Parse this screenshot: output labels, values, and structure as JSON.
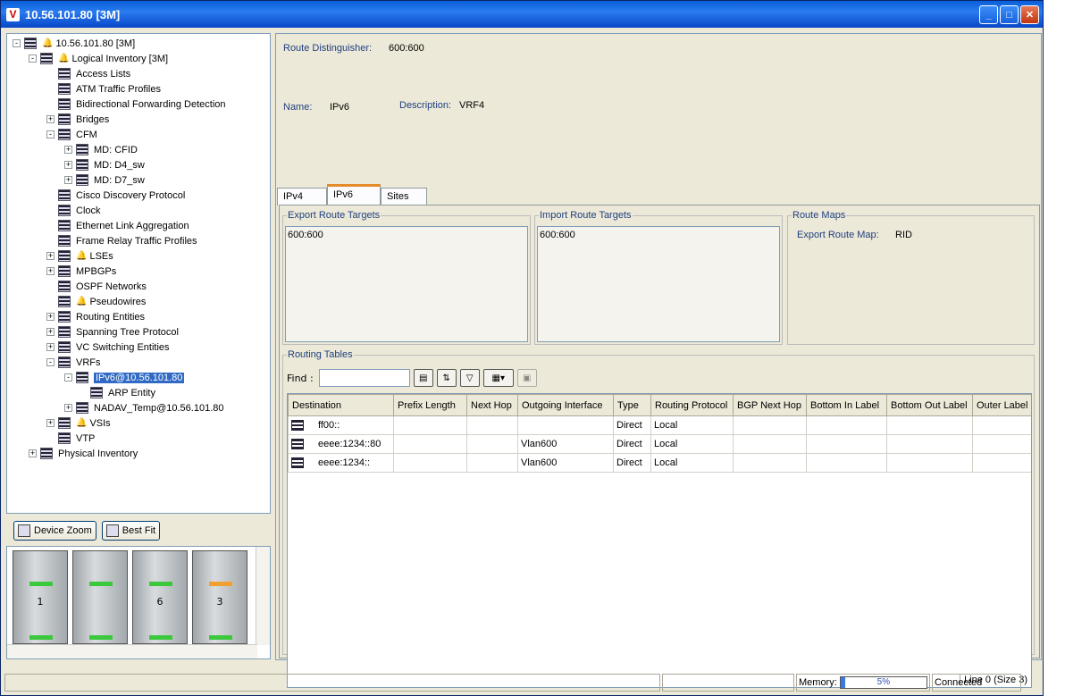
{
  "window": {
    "title": "10.56.101.80 [3M]",
    "logo": "V"
  },
  "tree": [
    {
      "label": "10.56.101.80 [3M]",
      "level": 0,
      "expander": "-",
      "bell": true,
      "icon": "device-icon"
    },
    {
      "label": "Logical Inventory [3M]",
      "level": 1,
      "expander": "-",
      "bell": true,
      "icon": "inventory-icon"
    },
    {
      "label": "Access Lists",
      "level": 2,
      "expander": "",
      "icon": "grid-icon"
    },
    {
      "label": "ATM Traffic Profiles",
      "level": 2,
      "expander": "",
      "icon": "grid-icon"
    },
    {
      "label": "Bidirectional Forwarding Detection",
      "level": 2,
      "expander": "",
      "icon": "grid-icon"
    },
    {
      "label": "Bridges",
      "level": 2,
      "expander": "+",
      "icon": "grid-icon"
    },
    {
      "label": "CFM",
      "level": 2,
      "expander": "-",
      "icon": "cfm-icon"
    },
    {
      "label": "MD: CFID",
      "level": 3,
      "expander": "+",
      "icon": "md-icon"
    },
    {
      "label": "MD: D4_sw",
      "level": 3,
      "expander": "+",
      "icon": "md-icon"
    },
    {
      "label": "MD: D7_sw",
      "level": 3,
      "expander": "+",
      "icon": "md-icon"
    },
    {
      "label": "Cisco Discovery Protocol",
      "level": 2,
      "expander": "",
      "icon": "grid-icon"
    },
    {
      "label": "Clock",
      "level": 2,
      "expander": "",
      "icon": "grid-icon"
    },
    {
      "label": "Ethernet Link Aggregation",
      "level": 2,
      "expander": "",
      "icon": "grid-icon"
    },
    {
      "label": "Frame Relay Traffic Profiles",
      "level": 2,
      "expander": "",
      "icon": "grid-icon"
    },
    {
      "label": "LSEs",
      "level": 2,
      "expander": "+",
      "bell": true,
      "icon": "grid-icon"
    },
    {
      "label": "MPBGPs",
      "level": 2,
      "expander": "+",
      "icon": "grid-icon"
    },
    {
      "label": "OSPF Networks",
      "level": 2,
      "expander": "",
      "icon": "grid-icon"
    },
    {
      "label": "Pseudowires",
      "level": 2,
      "expander": "",
      "bell": true,
      "icon": "grid-icon"
    },
    {
      "label": "Routing Entities",
      "level": 2,
      "expander": "+",
      "icon": "grid-icon"
    },
    {
      "label": "Spanning Tree Protocol",
      "level": 2,
      "expander": "+",
      "icon": "grid-icon"
    },
    {
      "label": "VC Switching Entities",
      "level": 2,
      "expander": "+",
      "icon": "grid-icon"
    },
    {
      "label": "VRFs",
      "level": 2,
      "expander": "-",
      "icon": "grid-icon"
    },
    {
      "label": "IPv6@10.56.101.80",
      "level": 3,
      "expander": "-",
      "icon": "grid-icon",
      "selected": true
    },
    {
      "label": "ARP Entity",
      "level": 4,
      "expander": "",
      "icon": "grid-icon"
    },
    {
      "label": "NADAV_Temp@10.56.101.80",
      "level": 3,
      "expander": "+",
      "icon": "grid-icon"
    },
    {
      "label": "VSIs",
      "level": 2,
      "expander": "+",
      "bell": true,
      "icon": "grid-icon"
    },
    {
      "label": "VTP",
      "level": 2,
      "expander": "",
      "icon": "mail-icon"
    },
    {
      "label": "Physical Inventory",
      "level": 1,
      "expander": "+",
      "icon": "physical-icon"
    }
  ],
  "zoom": {
    "device_zoom": "Device Zoom",
    "best_fit": "Best Fit"
  },
  "racks": [
    {
      "num": "1",
      "led": "#3cc83c"
    },
    {
      "num": "",
      "led": "#3cc83c"
    },
    {
      "num": "6",
      "led": "#3cc83c"
    },
    {
      "num": "3",
      "led": "#f0a030"
    }
  ],
  "details": {
    "rd_label": "Route Distinguisher:",
    "rd_value": "600:600",
    "name_label": "Name:",
    "name_value": "IPv6",
    "desc_label": "Description:",
    "desc_value": "VRF4"
  },
  "tabs": [
    "IPv4",
    "IPv6",
    "Sites"
  ],
  "export_rt": {
    "title": "Export Route Targets",
    "items": [
      "600:600"
    ]
  },
  "import_rt": {
    "title": "Import Route Targets",
    "items": [
      "600:600"
    ]
  },
  "route_maps": {
    "title": "Route Maps",
    "label": "Export Route Map:",
    "value": "RID"
  },
  "routing": {
    "title": "Routing Tables",
    "find_label": "Find :",
    "columns": [
      "Destination",
      "Prefix Length",
      "Next Hop",
      "Outgoing Interface",
      "Type",
      "Routing Protocol",
      "BGP Next Hop",
      "Bottom In Label",
      "Bottom Out Label",
      "Outer Label"
    ],
    "rows": [
      [
        "ff00::",
        "",
        "",
        "",
        "Direct",
        "Local",
        "",
        "",
        "",
        ""
      ],
      [
        "eeee:1234::80",
        "",
        "",
        "Vlan600",
        "Direct",
        "Local",
        "",
        "",
        "",
        ""
      ],
      [
        "eeee:1234::",
        "",
        "",
        "Vlan600",
        "Direct",
        "Local",
        "",
        "",
        "",
        ""
      ]
    ],
    "line_info": "Line 0 (Size 3)"
  },
  "status": {
    "memory_label": "Memory:",
    "memory_value": "5%",
    "memory_fraction": 0.05,
    "connection": "Connected"
  },
  "side_id": "196216"
}
